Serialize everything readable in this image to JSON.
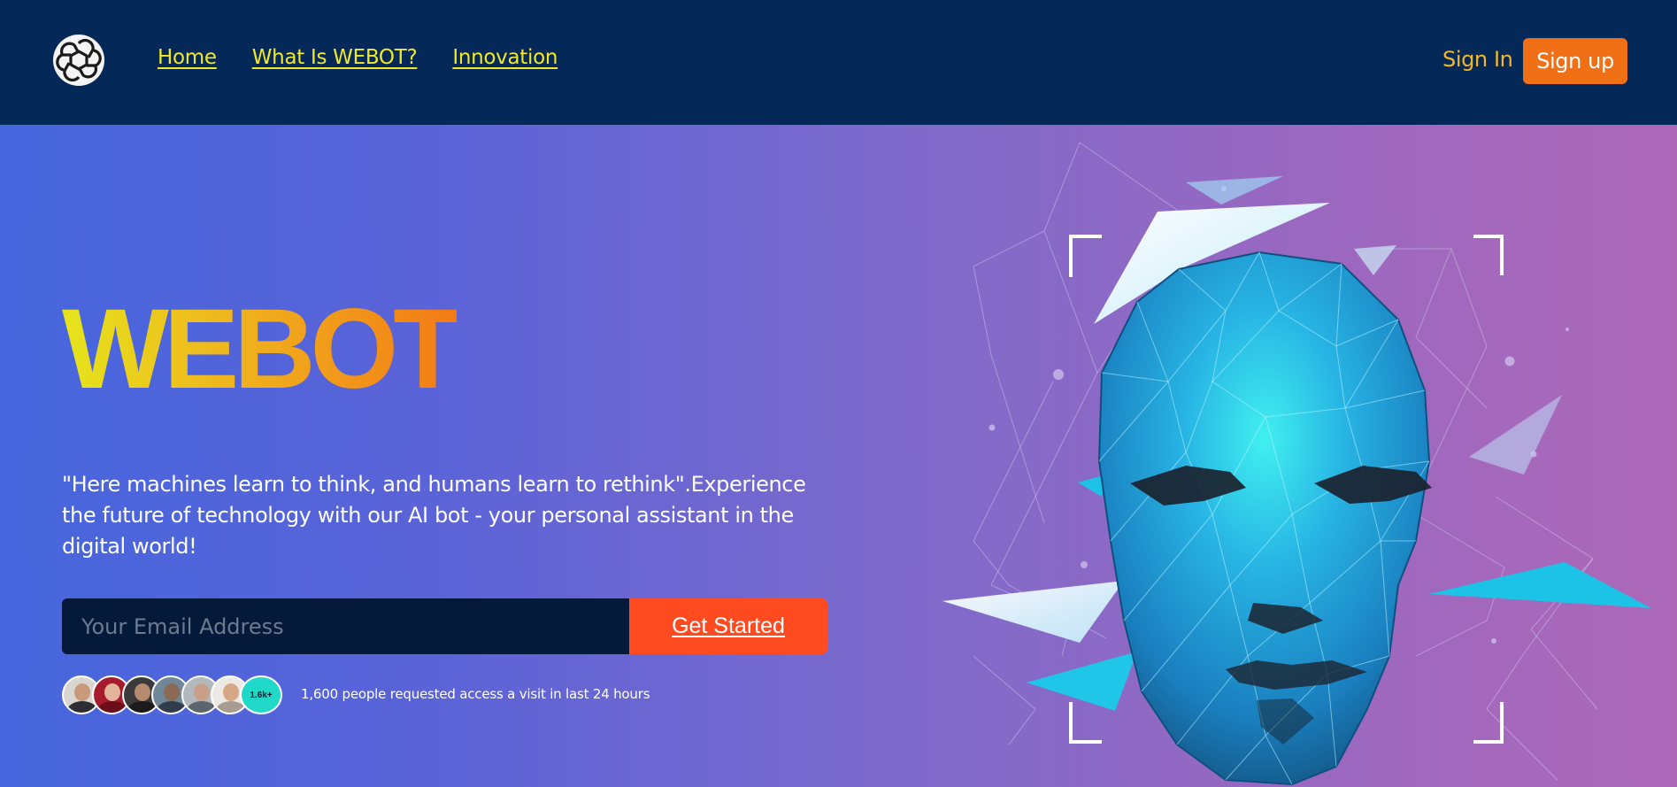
{
  "nav": {
    "logo_icon": "openai-knot-icon",
    "links": [
      {
        "label": "Home"
      },
      {
        "label": "What Is WEBOT?"
      },
      {
        "label": "Innovation"
      }
    ],
    "signin_label": "Sign In",
    "signup_label": "Sign up"
  },
  "hero": {
    "title": "WEBOT",
    "tagline": "\"Here machines learn to think, and humans learn to rethink\".Experience the future of technology with our AI bot - your personal assistant in the digital world!",
    "email_placeholder": "Your Email Address",
    "cta_label": "Get Started",
    "avatar_count_badge": "1.6k+",
    "social_proof": "1,600 people requested access a visit in last 24 hours"
  },
  "colors": {
    "nav_bg": "#042857",
    "link_yellow": "#f2e82a",
    "signup_orange": "#f27015",
    "cta_red": "#ff4b1f",
    "input_bg": "#051a3a",
    "badge_teal": "#1fd8c8"
  }
}
